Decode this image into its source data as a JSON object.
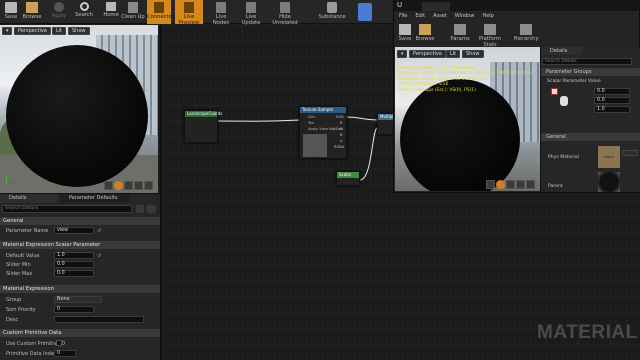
{
  "toolbar": {
    "buttons": [
      "Save",
      "Browse",
      "Apply",
      "Search",
      "Home",
      "Clean Up",
      "Connectors",
      "Live Preview",
      "Live Nodes",
      "Live Update",
      "Hide Unrelated",
      "Substance"
    ]
  },
  "viewport": {
    "perspective": "Perspective",
    "lit": "Lit",
    "show": "Show"
  },
  "details": {
    "tab": "Details",
    "tab2": "Parameter Defaults",
    "search_placeholder": "Search Details",
    "sections": {
      "general": "General",
      "scalar": "Material Expression Scalar Parameter",
      "expression": "Material Expression",
      "custom": "Custom Primitive Data"
    },
    "rows": {
      "param_name_label": "Parameter Name",
      "param_name_value": "view",
      "default_label": "Default Value",
      "default_value": "1.0",
      "slider_min_label": "Slider Min",
      "slider_min_value": "0.0",
      "slider_max_label": "Slider Max",
      "slider_max_value": "0.0",
      "group_label": "Group",
      "group_value": "None",
      "sort_label": "Sort Priority",
      "sort_value": "0",
      "desc_label": "Desc",
      "use_custom_label": "Use Custom Primitive D",
      "prim_index_label": "Primitive Data Index",
      "prim_index_value": "0"
    }
  },
  "graph": {
    "node_landscape": "LandscapeCoords",
    "node_texture": "Texture Sample",
    "node_multiply": "Multiply",
    "node_scalar": "Scalar",
    "texture_pins": [
      "UVs",
      "Tex",
      "Apply View MipBias"
    ],
    "texture_outs": [
      "RGB",
      "R",
      "G",
      "B",
      "A",
      "RGBA"
    ]
  },
  "instance_window": {
    "menu": [
      "File",
      "Edit",
      "Asset",
      "Window",
      "Help"
    ],
    "toolbar": [
      "Save",
      "Browse",
      "Params",
      "Platform Stats",
      "Hierarchy"
    ],
    "viewport": {
      "perspective": "Perspective",
      "lit": "Lit",
      "show": "Show"
    },
    "stats": [
      "Base pass shader: 111 instructions",
      "Base pass shader with Volumetric Lightmap: 186 instructions",
      "Base pass vertex shader: 44 instructions",
      "Texture samplers: 4/16",
      "Texture Lookups (Est.): VS(0), PS(1)"
    ],
    "details": {
      "tab": "Details",
      "search_placeholder": "Search Details",
      "param_groups": "Parameter Groups",
      "scalar_group": "Scalar Parameter Value",
      "val1": "0.0",
      "val2": "0.0",
      "val3": "1.0",
      "general": "General",
      "phys_material": "Phys Material",
      "phys_value": "None",
      "parent": "Parent"
    }
  },
  "watermark": "MATERIAL"
}
